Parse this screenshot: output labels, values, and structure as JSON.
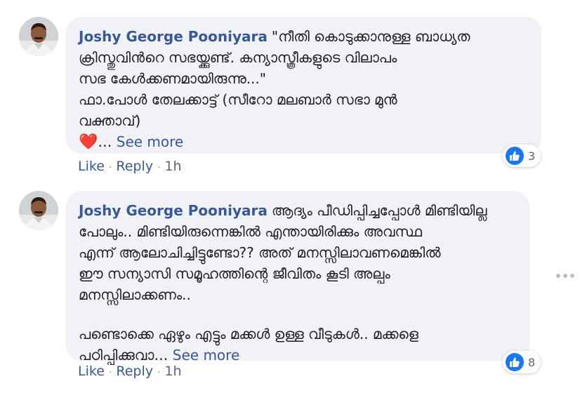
{
  "comments": [
    {
      "author": "Joshy George Pooniyara",
      "lines": [
        "\"നീതി കൊടുക്കാനുള്ള ബാധ്യത",
        "ക്രിസ്തുവിൻറെ സഭയ്ക്കുണ്ട്. കന്യാസ്ത്രീകളുടെ വിലാപം",
        "സഭ കേൾക്കണമായിരുന്നു...\"",
        "ഫാ.പോൾ തേലക്കാട്ട് (സീറോ മലബാർ സഭാ മുൻ",
        "വക്താവ്)"
      ],
      "ellipsis": "…",
      "see_more": "See more",
      "actions": {
        "like": "Like",
        "reply": "Reply",
        "time": "1h",
        "separator": "·"
      },
      "reaction_count": "3"
    },
    {
      "author": "Joshy George Pooniyara",
      "lines": [
        "ആദ്യം പീഡിപ്പിച്ചപ്പോൾ മിണ്ടിയില്ല",
        "പോലും.. മിണ്ടിയിരുന്നെങ്കിൽ എന്തായിരിക്കും അവസ്ഥ",
        "എന്ന് ആലോചിച്ചിട്ടുണ്ടോ?? അത് മനസ്സിലാവണമെങ്കിൽ",
        "ഈ സന്യാസി സമൂഹത്തിന്റെ ജീവിതം കൂടി അല്പം",
        "മനസ്സിലാക്കണം.."
      ],
      "lines2": [
        "പണ്ടൊക്കെ ഏഴും എട്ടും മക്കൾ ഉള്ള വീടുകൾ.. മക്കളെ",
        "പഠിപ്പിക്കുവാ…"
      ],
      "see_more": "See more",
      "actions": {
        "like": "Like",
        "reply": "Reply",
        "time": "1h",
        "separator": "·"
      },
      "reaction_count": "8"
    }
  ],
  "icons": {
    "reaction": "like-thumb-icon",
    "heart": "heart-emoji-icon",
    "more": "more-options-icon"
  },
  "colors": {
    "author": "#385898",
    "bubble": "#f0f2f5",
    "like_blue": "#1877f2",
    "heart": "#e0245e"
  }
}
